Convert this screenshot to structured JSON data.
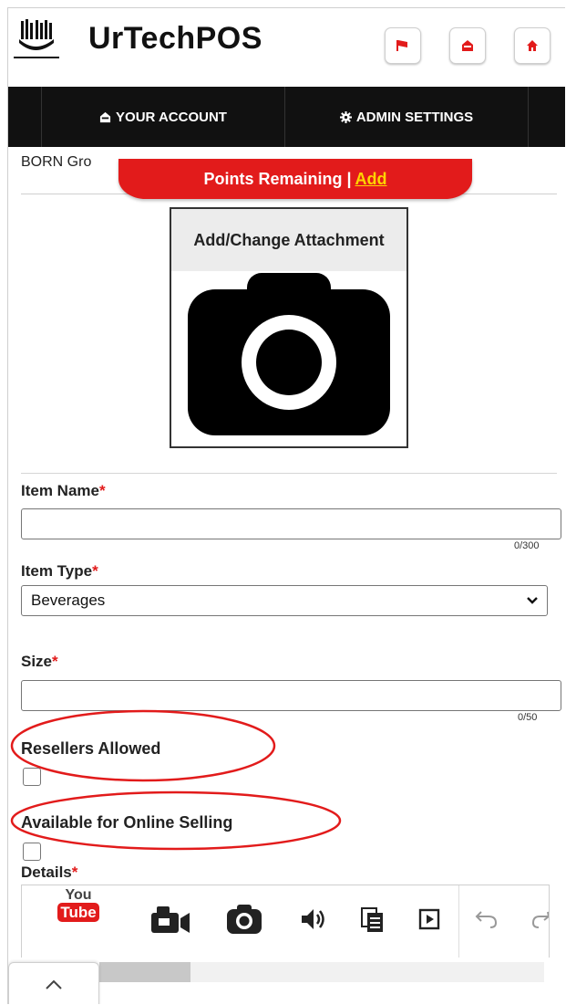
{
  "header": {
    "app_title": "UrTechPOS",
    "buttons": [
      "flag-icon",
      "inbox-icon",
      "home-icon"
    ],
    "button_color": "#e21b1b"
  },
  "nav": {
    "items": [
      {
        "label": "YOUR ACCOUNT",
        "icon": "inbox-icon"
      },
      {
        "label": "ADMIN SETTINGS",
        "icon": "gear-icon"
      }
    ]
  },
  "content": {
    "org_name": "BORN Gro",
    "points_banner": {
      "text": "Points Remaining |",
      "link": "Add"
    },
    "attachment": {
      "title": "Add/Change Attachment",
      "icon": "camera-icon"
    },
    "fields": {
      "item_name": {
        "label": "Item Name",
        "required": "*",
        "value": "",
        "counter": "0/300"
      },
      "item_type": {
        "label": "Item Type",
        "required": "*",
        "selected": "Beverages"
      },
      "size": {
        "label": "Size",
        "required": "*",
        "value": "",
        "counter": "0/50"
      },
      "resellers_allowed": {
        "label": "Resellers Allowed",
        "checked": false
      },
      "online_selling": {
        "label": "Available for Online Selling",
        "checked": false
      },
      "details": {
        "label": "Details",
        "required": "*"
      }
    },
    "toolbar": {
      "icons": [
        "youtube-icon",
        "video-icon",
        "camera-icon",
        "audio-icon",
        "paste-icon",
        "media-icon",
        "undo-icon",
        "redo-icon"
      ],
      "youtube_top": "You",
      "youtube_bottom": "Tube"
    },
    "annotation_color": "#e21b1b"
  }
}
